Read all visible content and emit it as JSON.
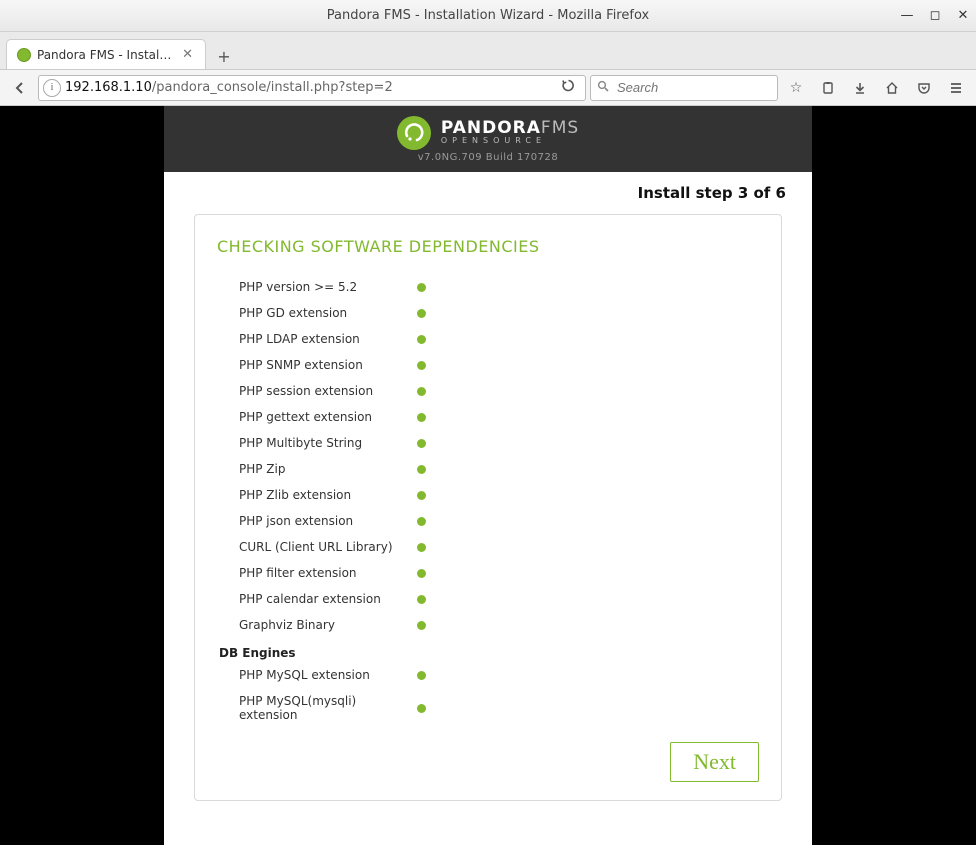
{
  "window": {
    "title": "Pandora FMS - Installation Wizard - Mozilla Firefox"
  },
  "tab": {
    "title": "Pandora FMS - Install..."
  },
  "url": {
    "host": "192.168.1.10",
    "path": "/pandora_console/install.php?step=2"
  },
  "search": {
    "placeholder": "Search"
  },
  "brand": {
    "name_bold": "PANDORA",
    "name_light": "FMS",
    "tagline": "OPENSOURCE",
    "version": "v7.0NG.709 Build 170728"
  },
  "step": {
    "text": "Install step 3 of 6"
  },
  "panel": {
    "heading": "CHECKING SOFTWARE DEPENDENCIES",
    "deps": [
      "PHP version >= 5.2",
      "PHP GD extension",
      "PHP LDAP extension",
      "PHP SNMP extension",
      "PHP session extension",
      "PHP gettext extension",
      "PHP Multibyte String",
      "PHP Zip",
      "PHP Zlib extension",
      "PHP json extension",
      "CURL (Client URL Library)",
      "PHP filter extension",
      "PHP calendar extension",
      "Graphviz Binary"
    ],
    "db_heading": "DB Engines",
    "db_deps": [
      "PHP MySQL extension",
      "PHP MySQL(mysqli) extension"
    ],
    "next_label": "Next"
  },
  "colors": {
    "accent": "#82b92e"
  }
}
